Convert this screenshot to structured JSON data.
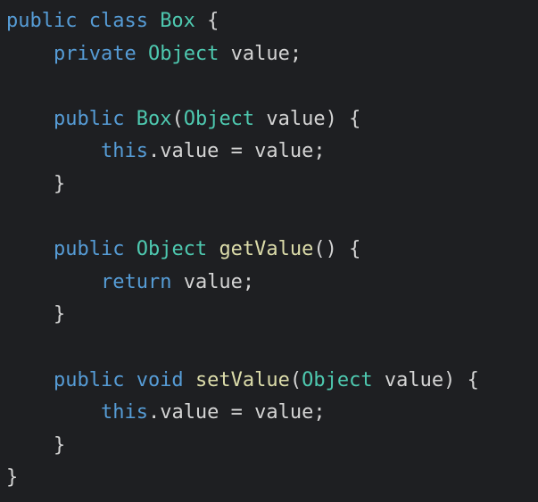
{
  "colors": {
    "background": "#1e1f22",
    "keyword": "#569cd6",
    "type": "#4ec9b0",
    "function": "#dcdcaa",
    "text": "#d4d4d4"
  },
  "code_lines": [
    [
      [
        "public class ",
        "kw"
      ],
      [
        "Box",
        "ty"
      ],
      [
        " {",
        "tx"
      ]
    ],
    [
      [
        "    ",
        "tx"
      ],
      [
        "private ",
        "kw"
      ],
      [
        "Object",
        "ty"
      ],
      [
        " value;",
        "tx"
      ]
    ],
    [],
    [
      [
        "    ",
        "tx"
      ],
      [
        "public ",
        "kw"
      ],
      [
        "Box",
        "ty"
      ],
      [
        "(",
        "tx"
      ],
      [
        "Object",
        "ty"
      ],
      [
        " value) {",
        "tx"
      ]
    ],
    [
      [
        "        ",
        "tx"
      ],
      [
        "this",
        "kw"
      ],
      [
        ".value = value;",
        "tx"
      ]
    ],
    [
      [
        "    }",
        "tx"
      ]
    ],
    [],
    [
      [
        "    ",
        "tx"
      ],
      [
        "public ",
        "kw"
      ],
      [
        "Object",
        "ty"
      ],
      [
        " ",
        "tx"
      ],
      [
        "getValue",
        "fn"
      ],
      [
        "() {",
        "tx"
      ]
    ],
    [
      [
        "        ",
        "tx"
      ],
      [
        "return",
        "kw"
      ],
      [
        " value;",
        "tx"
      ]
    ],
    [
      [
        "    }",
        "tx"
      ]
    ],
    [],
    [
      [
        "    ",
        "tx"
      ],
      [
        "public void ",
        "kw"
      ],
      [
        "setValue",
        "fn"
      ],
      [
        "(",
        "tx"
      ],
      [
        "Object",
        "ty"
      ],
      [
        " value) {",
        "tx"
      ]
    ],
    [
      [
        "        ",
        "tx"
      ],
      [
        "this",
        "kw"
      ],
      [
        ".value = value;",
        "tx"
      ]
    ],
    [
      [
        "    }",
        "tx"
      ]
    ],
    [
      [
        "}",
        "tx"
      ]
    ]
  ]
}
